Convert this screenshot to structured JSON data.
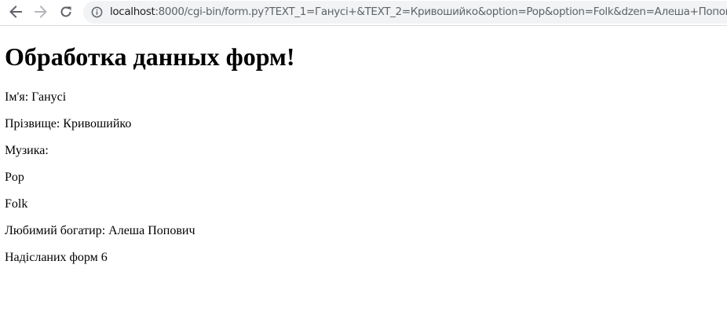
{
  "browser": {
    "url_host": "localhost",
    "url_rest": ":8000/cgi-bin/form.py?TEXT_1=Ганусі+&TEXT_2=Кривошийко&option=Pop&option=Folk&dzen=Алеша+Попович",
    "icons": {
      "back": "arrow-left-icon",
      "forward": "arrow-right-icon",
      "reload": "reload-icon",
      "site_info": "info-icon"
    }
  },
  "page": {
    "title": "Обработка данных форм!",
    "lines": [
      "Ім'я: Ганусі",
      "Прізвище: Кривошийко",
      "Музика:",
      "Pop",
      "Folk",
      "Любимий богатир: Алеша Попович",
      "Надісланих форм 6"
    ]
  }
}
